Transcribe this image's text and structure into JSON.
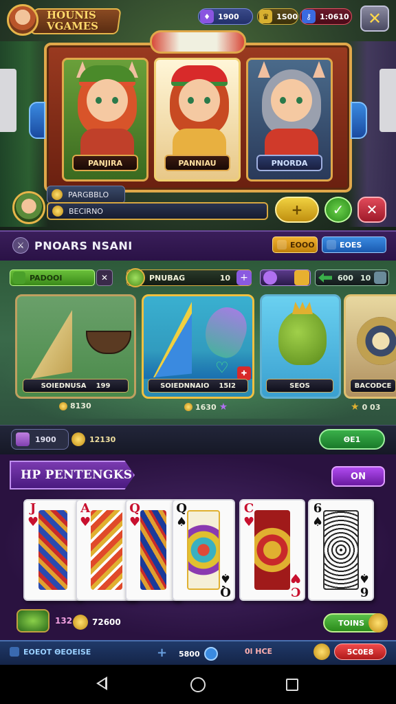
{
  "header": {
    "logo_text": "HOUNIS VGAMES",
    "resources": [
      {
        "icon": "gem-icon",
        "value": "1900"
      },
      {
        "icon": "gold-icon",
        "value": "1S00"
      },
      {
        "icon": "key-icon",
        "value": "1:0610"
      }
    ],
    "close_icon": "✕"
  },
  "characters": [
    {
      "name": "PANJIRA"
    },
    {
      "name": "PANNIAU"
    },
    {
      "name": "PNORDA"
    }
  ],
  "info": {
    "line1": "PARGBBLO",
    "line2": "BECIRNO",
    "plus_label": "+",
    "confirm_label": "✓",
    "cancel_label": "✕"
  },
  "section": {
    "title": "PNOARS NSANI",
    "orange_pill": "EOOO",
    "blue_pill": "EOES"
  },
  "stats": {
    "stat1": "PADOOI",
    "stat1_x": "✕",
    "stat2_label": "PNUBAG",
    "stat2_value": "10",
    "stat2_plus": "+",
    "stat3": "",
    "stat4_a": "600",
    "stat4_b": "10"
  },
  "games": [
    {
      "label": "SOIEDNUSA",
      "num": "199",
      "reward": "8130"
    },
    {
      "label": "SOIEDNNAIO",
      "num": "15I2",
      "reward": "1630"
    },
    {
      "label": "SEOS",
      "num": "",
      "reward": ""
    },
    {
      "label": "BACODCE",
      "num": "",
      "reward": "0 03"
    }
  ],
  "games_footer": {
    "chip1": "1900",
    "chip2": "12130",
    "chip3": "ΘE1"
  },
  "cards": {
    "banner": "HP PENTENGKS",
    "toggle": "ON",
    "items": [
      {
        "rank": "J",
        "suit": "♥",
        "color": "red"
      },
      {
        "rank": "A",
        "suit": "♥",
        "color": "red"
      },
      {
        "rank": "Q",
        "suit": "♥",
        "color": "red"
      },
      {
        "rank": "Q",
        "suit": "♠",
        "color": "blk"
      },
      {
        "rank": "C",
        "suit": "♥",
        "color": "red"
      },
      {
        "rank": "6",
        "suit": "♠",
        "color": "blk"
      }
    ],
    "foot_num1": "132",
    "foot_num2": "72600",
    "foot_button": "TOINS"
  },
  "bottom_bar": {
    "left": "EOEOT ΘEOEISE",
    "plus": "+",
    "mid": "5800",
    "right_mid": "0l HCE",
    "right_button": "5C0E8"
  }
}
